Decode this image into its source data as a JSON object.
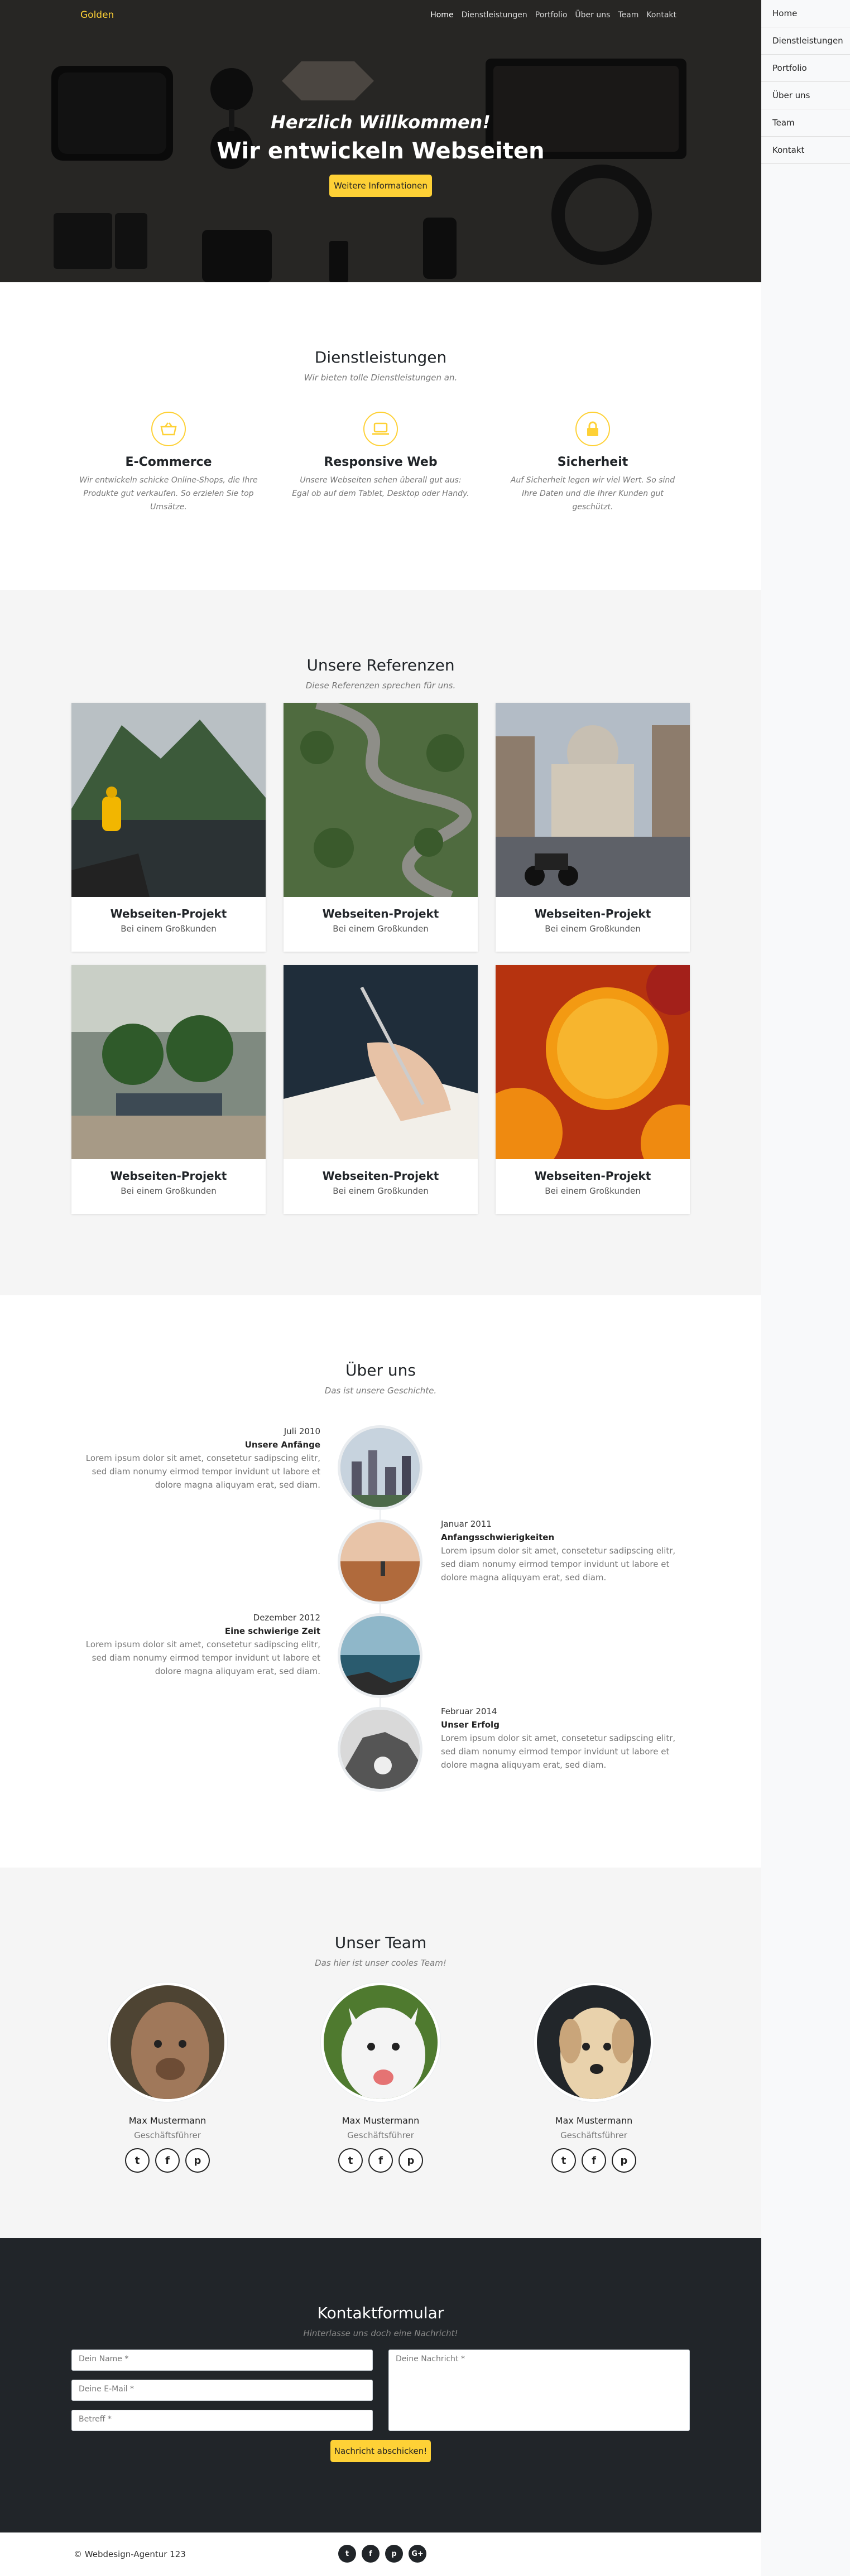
{
  "nav": {
    "brand": "Golden",
    "links": [
      "Home",
      "Dienstleistungen",
      "Portfolio",
      "Über uns",
      "Team",
      "Kontakt"
    ]
  },
  "sidebar": {
    "items": [
      "Home",
      "Dienstleistungen",
      "Portfolio",
      "Über uns",
      "Team",
      "Kontakt"
    ]
  },
  "hero": {
    "subtitle": "Herzlich Willkommen!",
    "title": "Wir entwickeln Webseiten",
    "button": "Weitere Informationen"
  },
  "services": {
    "title": "Dienstleistungen",
    "subtitle": "Wir bieten tolle Dienstleistungen an.",
    "items": [
      {
        "icon": "basket-icon",
        "title": "E-Commerce",
        "text": "Wir entwickeln schicke Online-Shops, die Ihre Produkte gut verkaufen. So erzielen Sie top Umsätze."
      },
      {
        "icon": "laptop-icon",
        "title": "Responsive Web",
        "text": "Unsere Webseiten sehen überall gut aus: Egal ob auf dem Tablet, Desktop oder Handy."
      },
      {
        "icon": "lock-icon",
        "title": "Sicherheit",
        "text": "Auf Sicherheit legen wir viel Wert. So sind Ihre Daten und die Ihrer Kunden gut geschützt."
      }
    ]
  },
  "portfolio": {
    "title": "Unsere Referenzen",
    "subtitle": "Diese Referenzen sprechen für uns.",
    "items": [
      {
        "title": "Webseiten-Projekt",
        "subtitle": "Bei einem Großkunden"
      },
      {
        "title": "Webseiten-Projekt",
        "subtitle": "Bei einem Großkunden"
      },
      {
        "title": "Webseiten-Projekt",
        "subtitle": "Bei einem Großkunden"
      },
      {
        "title": "Webseiten-Projekt",
        "subtitle": "Bei einem Großkunden"
      },
      {
        "title": "Webseiten-Projekt",
        "subtitle": "Bei einem Großkunden"
      },
      {
        "title": "Webseiten-Projekt",
        "subtitle": "Bei einem Großkunden"
      }
    ]
  },
  "about": {
    "title": "Über uns",
    "subtitle": "Das ist unsere Geschichte.",
    "timeline": [
      {
        "date": "Juli 2010",
        "heading": "Unsere Anfänge",
        "text": "Lorem ipsum dolor sit amet, consetetur sadipscing elitr, sed diam nonumy eirmod tempor invidunt ut labore et dolore magna aliquyam erat, sed diam."
      },
      {
        "date": "Januar 2011",
        "heading": "Anfangsschwierigkeiten",
        "text": "Lorem ipsum dolor sit amet, consetetur sadipscing elitr, sed diam nonumy eirmod tempor invidunt ut labore et dolore magna aliquyam erat, sed diam."
      },
      {
        "date": "Dezember 2012",
        "heading": "Eine schwierige Zeit",
        "text": "Lorem ipsum dolor sit amet, consetetur sadipscing elitr, sed diam nonumy eirmod tempor invidunt ut labore et dolore magna aliquyam erat, sed diam."
      },
      {
        "date": "Februar 2014",
        "heading": "Unser Erfolg",
        "text": "Lorem ipsum dolor sit amet, consetetur sadipscing elitr, sed diam nonumy eirmod tempor invidunt ut labore et dolore magna aliquyam erat, sed diam."
      }
    ]
  },
  "team": {
    "title": "Unser Team",
    "subtitle": "Das hier ist unser cooles Team!",
    "members": [
      {
        "name": "Max Mustermann",
        "role": "Geschäftsführer"
      },
      {
        "name": "Max Mustermann",
        "role": "Geschäftsführer"
      },
      {
        "name": "Max Mustermann",
        "role": "Geschäftsführer"
      }
    ],
    "social_icons": [
      "twitter-icon",
      "facebook-icon",
      "pinterest-icon"
    ]
  },
  "contact": {
    "title": "Kontaktformular",
    "subtitle": "Hinterlasse uns doch eine Nachricht!",
    "name_placeholder": "Dein Name *",
    "email_placeholder": "Deine E-Mail *",
    "subject_placeholder": "Betreff *",
    "message_placeholder": "Deine Nachricht *",
    "button": "Nachricht abschicken!"
  },
  "footer": {
    "copyright": "© Webdesign-Agentur 123",
    "social_icons": [
      "twitter-icon",
      "facebook-icon",
      "pinterest-icon",
      "google-plus-icon"
    ]
  },
  "colors": {
    "accent": "#fed136",
    "dark": "#212529",
    "light": "#f8f9fa"
  }
}
